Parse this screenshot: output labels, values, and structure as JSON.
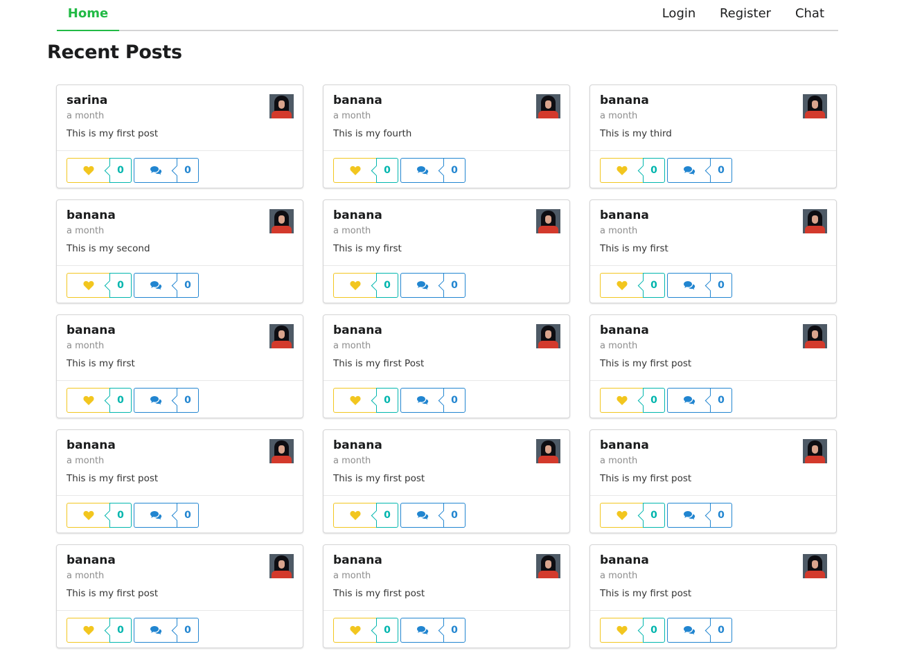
{
  "nav": {
    "home": "Home",
    "login": "Login",
    "register": "Register",
    "chat": "Chat"
  },
  "page_title": "Recent Posts",
  "colors": {
    "active_nav": "#21ba45",
    "like": "#f2c61f",
    "like_count": "#00b5ad",
    "comment": "#2185d0"
  },
  "icons": {
    "like": "heart-icon",
    "comment": "comment-icon"
  },
  "posts": [
    {
      "author": "sarina",
      "time": "a month",
      "body": "This is my first post",
      "likes": "0",
      "comments": "0"
    },
    {
      "author": "banana",
      "time": "a month",
      "body": "This is my fourth",
      "likes": "0",
      "comments": "0"
    },
    {
      "author": "banana",
      "time": "a month",
      "body": "This is my third",
      "likes": "0",
      "comments": "0"
    },
    {
      "author": "banana",
      "time": "a month",
      "body": "This is my second",
      "likes": "0",
      "comments": "0"
    },
    {
      "author": "banana",
      "time": "a month",
      "body": "This is my first",
      "likes": "0",
      "comments": "0"
    },
    {
      "author": "banana",
      "time": "a month",
      "body": "This is my first",
      "likes": "0",
      "comments": "0"
    },
    {
      "author": "banana",
      "time": "a month",
      "body": "This is my first",
      "likes": "0",
      "comments": "0"
    },
    {
      "author": "banana",
      "time": "a month",
      "body": "This is my first Post",
      "likes": "0",
      "comments": "0"
    },
    {
      "author": "banana",
      "time": "a month",
      "body": "This is my first post",
      "likes": "0",
      "comments": "0"
    },
    {
      "author": "banana",
      "time": "a month",
      "body": "This is my first post",
      "likes": "0",
      "comments": "0"
    },
    {
      "author": "banana",
      "time": "a month",
      "body": "This is my first post",
      "likes": "0",
      "comments": "0"
    },
    {
      "author": "banana",
      "time": "a month",
      "body": "This is my first post",
      "likes": "0",
      "comments": "0"
    },
    {
      "author": "banana",
      "time": "a month",
      "body": "This is my first post",
      "likes": "0",
      "comments": "0"
    },
    {
      "author": "banana",
      "time": "a month",
      "body": "This is my first post",
      "likes": "0",
      "comments": "0"
    },
    {
      "author": "banana",
      "time": "a month",
      "body": "This is my first post",
      "likes": "0",
      "comments": "0"
    }
  ]
}
